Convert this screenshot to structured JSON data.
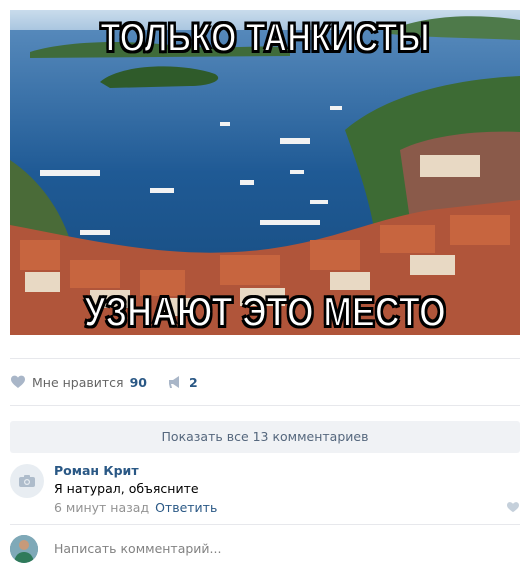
{
  "post": {
    "image": {
      "top_caption": "ТОЛЬКО ТАНКИСТЫ",
      "bottom_caption": "УЗНАЮТ ЭТО МЕСТО"
    }
  },
  "actions": {
    "like_label": "Мне нравится",
    "like_count": "90",
    "share_count": "2"
  },
  "comments": {
    "show_all_label": "Показать все 13 комментариев",
    "items": [
      {
        "author": "Роман Крит",
        "text": "Я натурал, объясните",
        "time": "6 минут назад",
        "reply_label": "Ответить"
      }
    ],
    "compose_placeholder": "Написать комментарий..."
  },
  "colors": {
    "link": "#2a5885",
    "muted": "#939393",
    "button_bg": "#f0f2f5"
  }
}
